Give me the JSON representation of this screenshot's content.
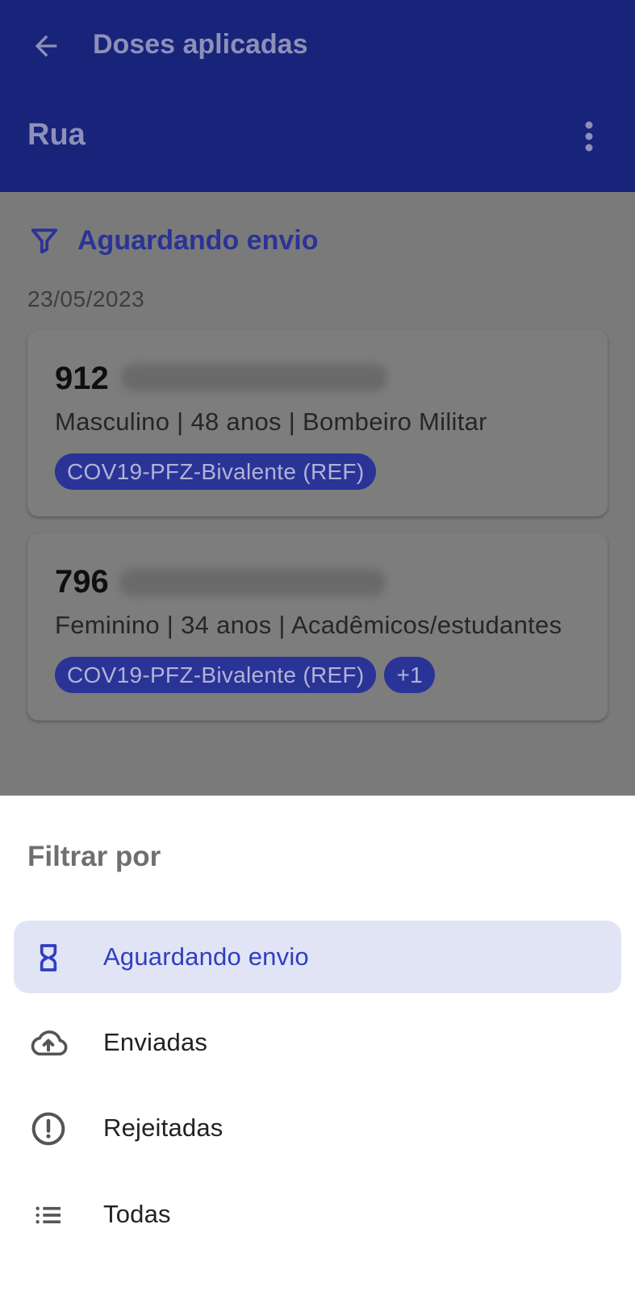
{
  "app_bar": {
    "title": "Doses aplicadas",
    "subtitle": "Rua",
    "back_icon": "arrow-left-icon",
    "menu_icon": "more-vertical-icon"
  },
  "filter": {
    "icon": "filter-icon",
    "label": "Aguardando envio"
  },
  "date_group": "23/05/2023",
  "records": [
    {
      "id": "912",
      "info": "Masculino | 48 anos | Bombeiro Militar",
      "tags": [
        "COV19-PFZ-Bivalente (REF)"
      ]
    },
    {
      "id": "796",
      "info": "Feminino | 34 anos | Acadêmicos/estudantes",
      "tags": [
        "COV19-PFZ-Bivalente (REF)",
        "+1"
      ]
    }
  ],
  "sheet": {
    "title": "Filtrar por",
    "items": [
      {
        "label": "Aguardando envio",
        "icon": "hourglass-icon",
        "selected": true
      },
      {
        "label": "Enviadas",
        "icon": "cloud-upload-icon",
        "selected": false
      },
      {
        "label": "Rejeitadas",
        "icon": "alert-circle-icon",
        "selected": false
      },
      {
        "label": "Todas",
        "icon": "list-icon",
        "selected": false
      }
    ]
  },
  "colors": {
    "app_bar": "#18237a",
    "accent": "#2f3fc0",
    "selected_item_bg": "#e1e4f5",
    "scrim_bg": "#7a7a7a"
  }
}
